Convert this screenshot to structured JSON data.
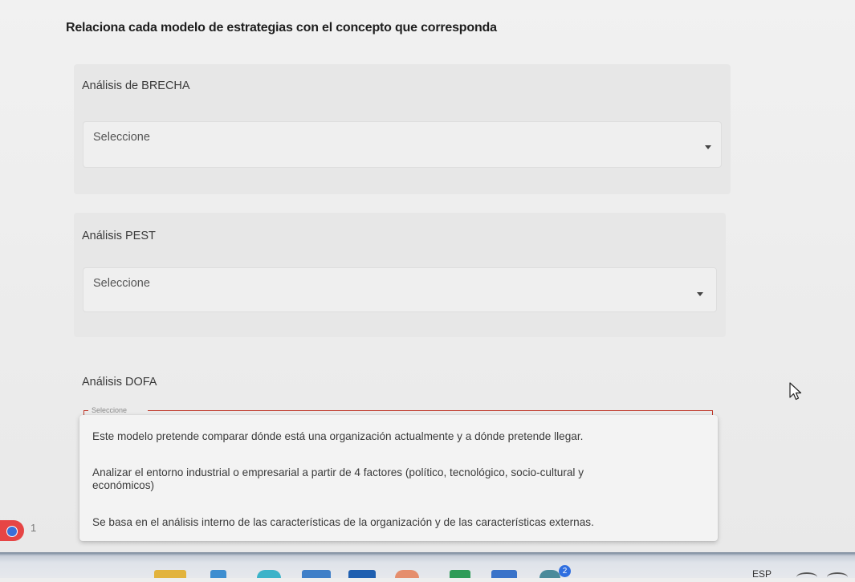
{
  "question": {
    "title": "Relaciona cada modelo de estrategias con el concepto que corresponda"
  },
  "items": [
    {
      "label": "Análisis de BRECHA",
      "selected": "Seleccione"
    },
    {
      "label": "Análisis PEST",
      "selected": "Seleccione"
    },
    {
      "label": "Análisis DOFA",
      "selected": "Seleccione"
    }
  ],
  "dropdown": {
    "legend": "Seleccione",
    "options": [
      "Este modelo pretende comparar dónde está una organización actualmente y a dónde pretende llegar.",
      "Analizar el entorno industrial o empresarial a partir de 4 factores (político, tecnológico, socio-cultural y económicos)",
      "Se basa en el análisis interno de las características de la organización y de las características externas."
    ]
  },
  "notification": {
    "count": "1",
    "color": "#e64545"
  },
  "taskbar": {
    "badge_count": "2",
    "language": "ESP"
  },
  "colors": {
    "focus_outline": "#c0392b"
  }
}
